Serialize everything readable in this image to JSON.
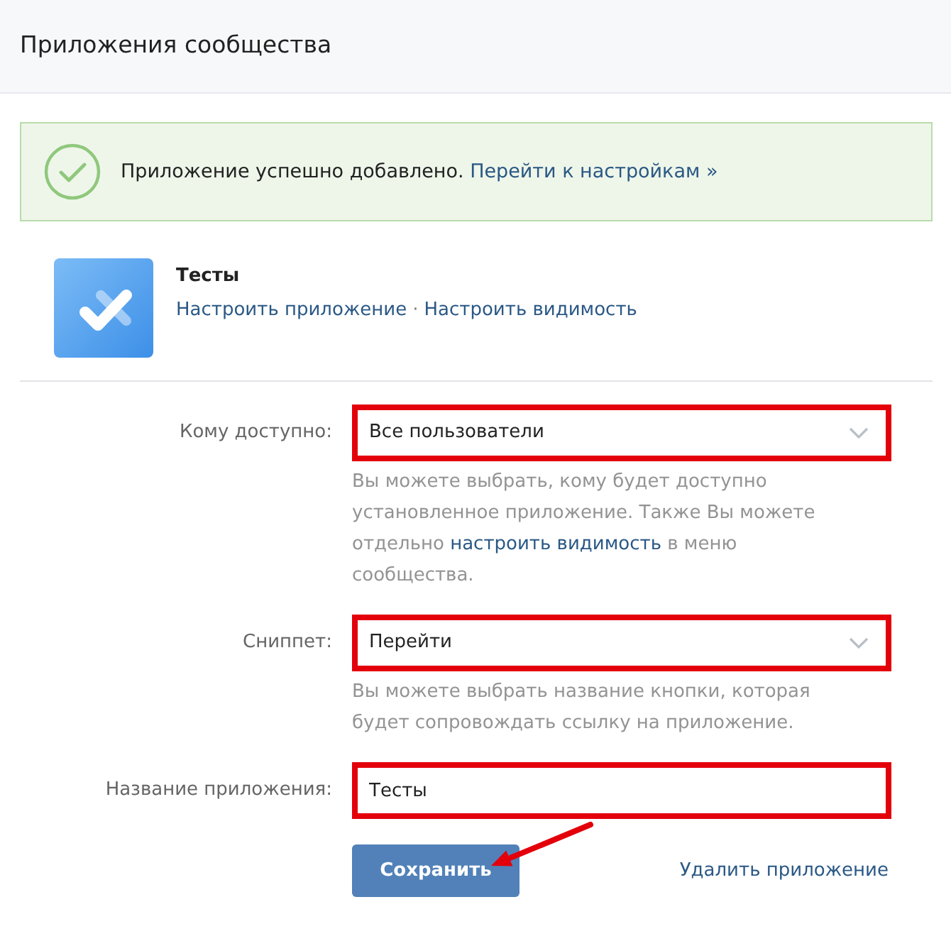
{
  "header": {
    "title": "Приложения сообщества"
  },
  "alert": {
    "kind": "success",
    "text": "Приложение успешно добавлено.",
    "link": "Перейти к настройкам »"
  },
  "app": {
    "title": "Тесты",
    "links": [
      "Настроить приложение",
      "Настроить видимость"
    ],
    "separator": "·"
  },
  "fields": [
    {
      "kind": "select",
      "label": "Кому доступно:",
      "value": "Все пользователи",
      "highlighted": true,
      "hint": [
        {
          "kind": "text",
          "text": "Вы можете выбрать, кому будет доступно установленное приложение. Также Вы можете отдельно "
        },
        {
          "kind": "link",
          "text": "настроить видимость"
        },
        {
          "kind": "text",
          "text": " в меню сообщества."
        }
      ]
    },
    {
      "kind": "select",
      "label": "Сниппет:",
      "value": "Перейти",
      "highlighted": true,
      "hint": [
        {
          "kind": "text",
          "text": "Вы можете выбрать название кнопки, которая будет сопровождать ссылку на приложение."
        }
      ]
    },
    {
      "kind": "text",
      "label": "Название приложения:",
      "value": "Тесты",
      "highlighted": true
    }
  ],
  "actions": {
    "save": {
      "label": "Сохранить",
      "pointer_arrow": true
    },
    "delete": {
      "label": "Удалить приложение"
    }
  }
}
